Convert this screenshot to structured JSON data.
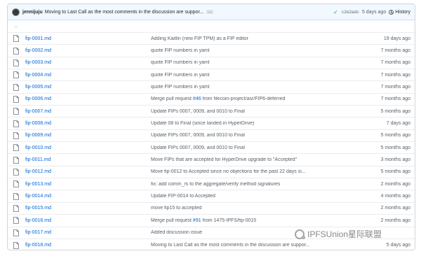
{
  "commit": {
    "author": "jennijuju",
    "message": "Moving to Last Call as the most comments in the discussion are suppor...",
    "ellipsis": "…",
    "sha": "c2e2adc",
    "age": "5 days ago",
    "history_label": "History",
    "status_color": "#28a745"
  },
  "parent_dir": "..",
  "files": [
    {
      "name": "fip-0001.md",
      "message": "Adding Kaitlin (new FIP TPM) as a FIP editor",
      "pr": "",
      "message_after": "",
      "date": "19 days ago"
    },
    {
      "name": "fip-0002.md",
      "message": "quote FIP numbers in yaml",
      "pr": "",
      "message_after": "",
      "date": "7 months ago"
    },
    {
      "name": "fip-0003.md",
      "message": "quote FIP numbers in yaml",
      "pr": "",
      "message_after": "",
      "date": "7 months ago"
    },
    {
      "name": "fip-0004.md",
      "message": "quote FIP numbers in yaml",
      "pr": "",
      "message_after": "",
      "date": "7 months ago"
    },
    {
      "name": "fip-0005.md",
      "message": "quote FIP numbers in yaml",
      "pr": "",
      "message_after": "",
      "date": "7 months ago"
    },
    {
      "name": "fip-0006.md",
      "message": "Merge pull request ",
      "pr": "#46",
      "message_after": " from filecoin-project/asr/FIP6-deferred",
      "date": "7 months ago"
    },
    {
      "name": "fip-0007.md",
      "message": "Update FIPs 0007, 0009, and 0010 to Final",
      "pr": "",
      "message_after": "",
      "date": "5 months ago"
    },
    {
      "name": "fip-0008.md",
      "message": "Update 08 to Final (since landed in HyperDrive)",
      "pr": "",
      "message_after": "",
      "date": "7 days ago"
    },
    {
      "name": "fip-0009.md",
      "message": "Update FIPs 0007, 0009, and 0010 to Final",
      "pr": "",
      "message_after": "",
      "date": "5 months ago"
    },
    {
      "name": "fip-0010.md",
      "message": "Update FIPs 0007, 0009, and 0010 to Final",
      "pr": "",
      "message_after": "",
      "date": "5 months ago"
    },
    {
      "name": "fip-0011.md",
      "message": "Move FIPs that are accepted for HyperDrive upgrade to \"Accepted\"",
      "pr": "",
      "message_after": "",
      "date": "3 months ago"
    },
    {
      "name": "fip-0012.md",
      "message": "Move fip-0012 to Accepted since no objections for the past 22 days si...",
      "pr": "",
      "message_after": "",
      "date": "5 months ago"
    },
    {
      "name": "fip-0013.md",
      "message": "fix: add comm_rs to the aggregate/verify method signatures",
      "pr": "",
      "message_after": "",
      "date": "2 months ago"
    },
    {
      "name": "fip-0014.md",
      "message": "Update FIP-0014 to Accepted",
      "pr": "",
      "message_after": "",
      "date": "4 months ago"
    },
    {
      "name": "fip-0015.md",
      "message": "move fip15 to accepted",
      "pr": "",
      "message_after": "",
      "date": "2 months ago"
    },
    {
      "name": "fip-0016.md",
      "message": "Merge pull request ",
      "pr": "#91",
      "message_after": " from 1475-IPFS/fip-0015",
      "date": "2 months ago"
    },
    {
      "name": "fip-0017.md",
      "message": "Added discussion issue",
      "pr": "",
      "message_after": "",
      "date": ""
    },
    {
      "name": "fip-0018.md",
      "message": "Moving to Last Call as the most comments in the discussion are suppor...",
      "pr": "",
      "message_after": "",
      "date": "5 days ago"
    }
  ],
  "watermark": {
    "text": "IPFSUnion星际联盟"
  }
}
